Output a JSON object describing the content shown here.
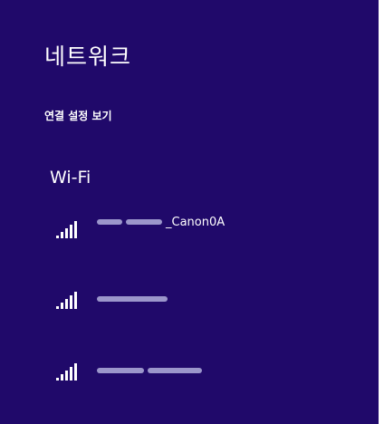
{
  "panel": {
    "title": "네트워크",
    "view_settings_link": "연결 설정 보기",
    "section_title": "Wi-Fi"
  },
  "networks": [
    {
      "ssid_suffix": "_Canon0A",
      "signal_icon": "wifi-signal-full-icon"
    },
    {
      "ssid_suffix": "",
      "signal_icon": "wifi-signal-full-icon"
    },
    {
      "ssid_suffix": "",
      "signal_icon": "wifi-signal-full-icon"
    }
  ],
  "colors": {
    "background": "#20096a",
    "text": "#ffffff",
    "obscured_text": "#a8a6d6"
  }
}
